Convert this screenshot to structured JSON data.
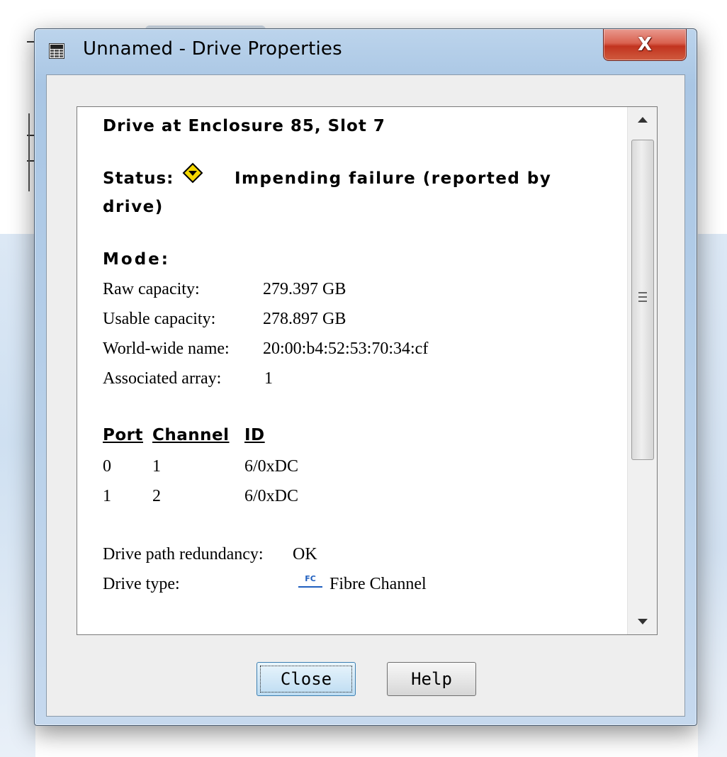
{
  "window": {
    "title": "Unnamed - Drive Properties",
    "close_glyph": "X"
  },
  "drive": {
    "heading": "Drive at Enclosure 85, Slot 7",
    "status_label": "Status:",
    "status_icon": "warning-diamond-icon",
    "status_text_line1": "Impending failure (reported by",
    "status_text_line2": "drive)",
    "mode_label": "Mode:",
    "properties": [
      {
        "label": "Raw capacity:",
        "value": "279.397 GB"
      },
      {
        "label": "Usable capacity:",
        "value": "278.897 GB"
      },
      {
        "label": "World-wide name:",
        "value": "20:00:b4:52:53:70:34:cf"
      },
      {
        "label": "Associated array:",
        "value": "1"
      }
    ],
    "paths_table": {
      "headers": [
        "Port",
        "Channel",
        "ID"
      ],
      "rows": [
        [
          "0",
          "1",
          "6/0xDC"
        ],
        [
          "1",
          "2",
          "6/0xDC"
        ]
      ]
    },
    "redundancy_label": "Drive path redundancy:",
    "redundancy_value": "OK",
    "type_label": "Drive type:",
    "type_icon_text": "FC",
    "type_value": "Fibre Channel"
  },
  "buttons": {
    "close": "Close",
    "help": "Help"
  },
  "colors": {
    "warning_fill": "#f5d800",
    "fc_icon": "#1f5fbf",
    "close_button_red": "#c2341f"
  }
}
